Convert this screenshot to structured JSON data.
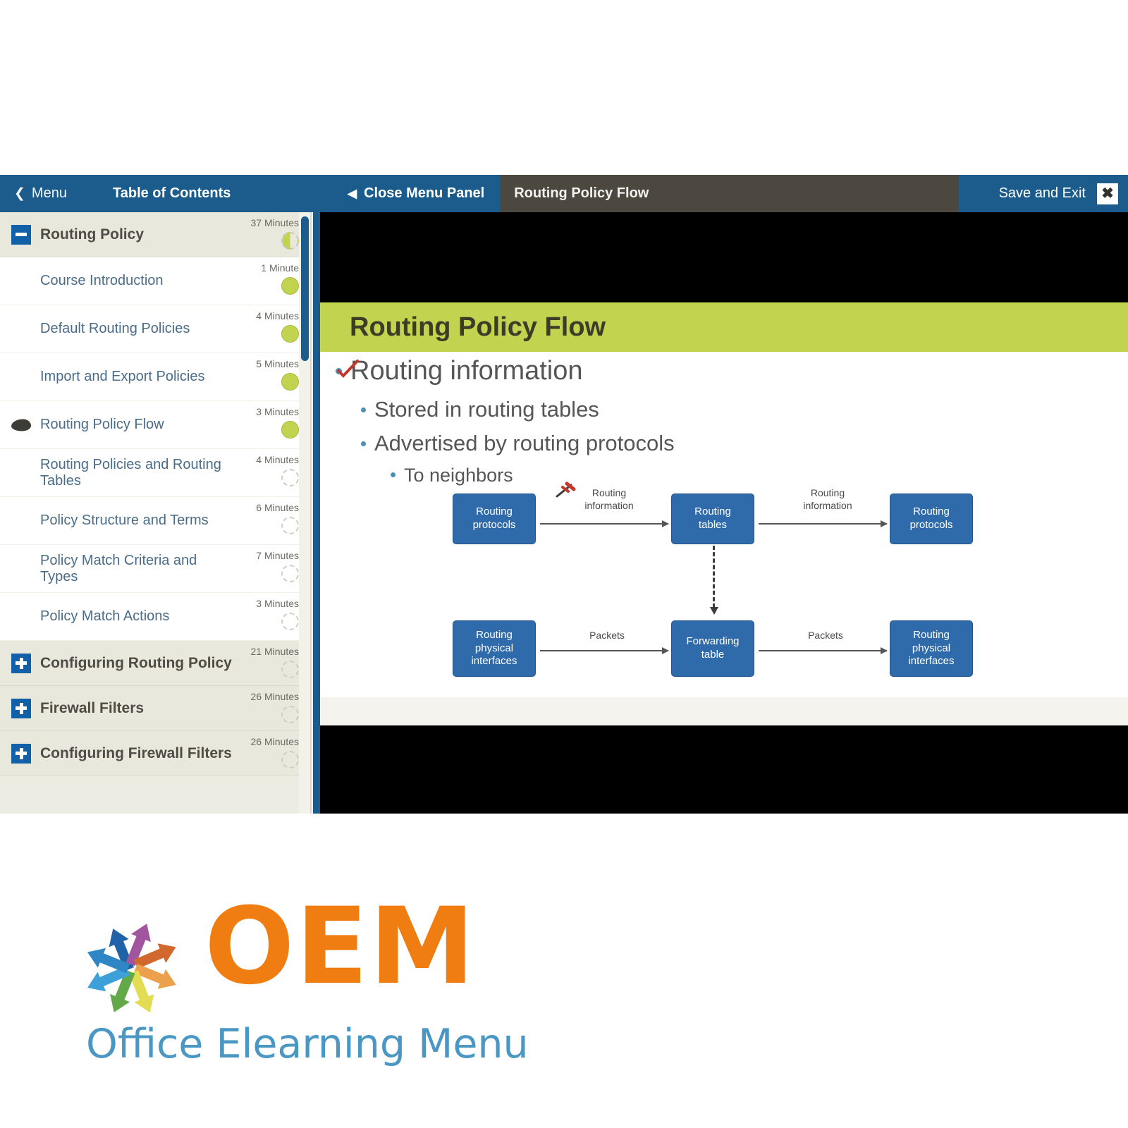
{
  "topbar": {
    "menu_label": "Menu",
    "menu_chevron": "chevron-left-icon",
    "toc_label": "Table of Contents",
    "close_panel_label": "Close Menu Panel",
    "close_panel_caret": "caret-left-icon",
    "slide_title": "Routing Policy Flow",
    "save_exit_label": "Save and Exit",
    "close_icon": "✖",
    "colors": {
      "bar": "#1b5c8c",
      "slide_title_bg": "#4c4840"
    }
  },
  "toc": {
    "groups": [
      {
        "label": "Routing Policy",
        "minutes": "37 Minutes",
        "expanded": true,
        "toggle_icon": "minus-icon",
        "status": "partial",
        "children": [
          {
            "label": "Course Introduction",
            "minutes": "1 Minute",
            "status": "done",
            "current": false
          },
          {
            "label": "Default Routing Policies",
            "minutes": "4 Minutes",
            "status": "done",
            "current": false
          },
          {
            "label": "Import and Export Policies",
            "minutes": "5 Minutes",
            "status": "done",
            "current": false
          },
          {
            "label": "Routing Policy Flow",
            "minutes": "3 Minutes",
            "status": "done",
            "current": true
          },
          {
            "label": "Routing Policies and Routing Tables",
            "minutes": "4 Minutes",
            "status": "todo",
            "current": false
          },
          {
            "label": "Policy Structure and Terms",
            "minutes": "6 Minutes",
            "status": "todo",
            "current": false
          },
          {
            "label": "Policy Match Criteria and Types",
            "minutes": "7 Minutes",
            "status": "todo",
            "current": false
          },
          {
            "label": "Policy Match Actions",
            "minutes": "3 Minutes",
            "status": "todo",
            "current": false
          }
        ]
      },
      {
        "label": "Configuring Routing Policy",
        "minutes": "21 Minutes",
        "expanded": false,
        "toggle_icon": "plus-icon",
        "status": "todo",
        "children": []
      },
      {
        "label": "Firewall Filters",
        "minutes": "26 Minutes",
        "expanded": false,
        "toggle_icon": "plus-icon",
        "status": "todo",
        "children": []
      },
      {
        "label": "Configuring Firewall Filters",
        "minutes": "26 Minutes",
        "expanded": false,
        "toggle_icon": "plus-icon",
        "status": "todo",
        "children": []
      }
    ]
  },
  "slide": {
    "title": "Routing Policy Flow",
    "band_color": "#c2d350",
    "bullets": {
      "level1": "Routing information",
      "level2_a": "Stored in routing tables",
      "level2_b": "Advertised by routing protocols",
      "level3": "To neighbors"
    },
    "annotation": "red-check-mark",
    "diagram": {
      "boxes": [
        {
          "id": "routing-protocols-left",
          "text": "Routing\nprotocols"
        },
        {
          "id": "routing-tables",
          "text": "Routing\ntables"
        },
        {
          "id": "routing-protocols-right",
          "text": "Routing\nprotocols"
        },
        {
          "id": "routing-physical-interfaces-left",
          "text": "Routing\nphysical\ninterfaces"
        },
        {
          "id": "forwarding-table",
          "text": "Forwarding\ntable"
        },
        {
          "id": "routing-physical-interfaces-right",
          "text": "Routing\nphysical\ninterfaces"
        }
      ],
      "labels": [
        {
          "id": "label-routing-information-1",
          "text": "Routing\ninformation"
        },
        {
          "id": "label-routing-information-2",
          "text": "Routing\ninformation"
        },
        {
          "id": "label-packets-1",
          "text": "Packets"
        },
        {
          "id": "label-packets-2",
          "text": "Packets"
        }
      ],
      "box_color": "#2f6bab"
    }
  },
  "logo": {
    "wordmark": "OEM",
    "tagline": "Office Elearning Menu",
    "wordmark_color": "#f07d12",
    "tagline_color": "#4a97c4",
    "arrow_colors": [
      "#1f62a8",
      "#a0559e",
      "#d1692e",
      "#eda04c",
      "#e3dd53",
      "#62a94a",
      "#3da0d8",
      "#2f86c5"
    ]
  }
}
